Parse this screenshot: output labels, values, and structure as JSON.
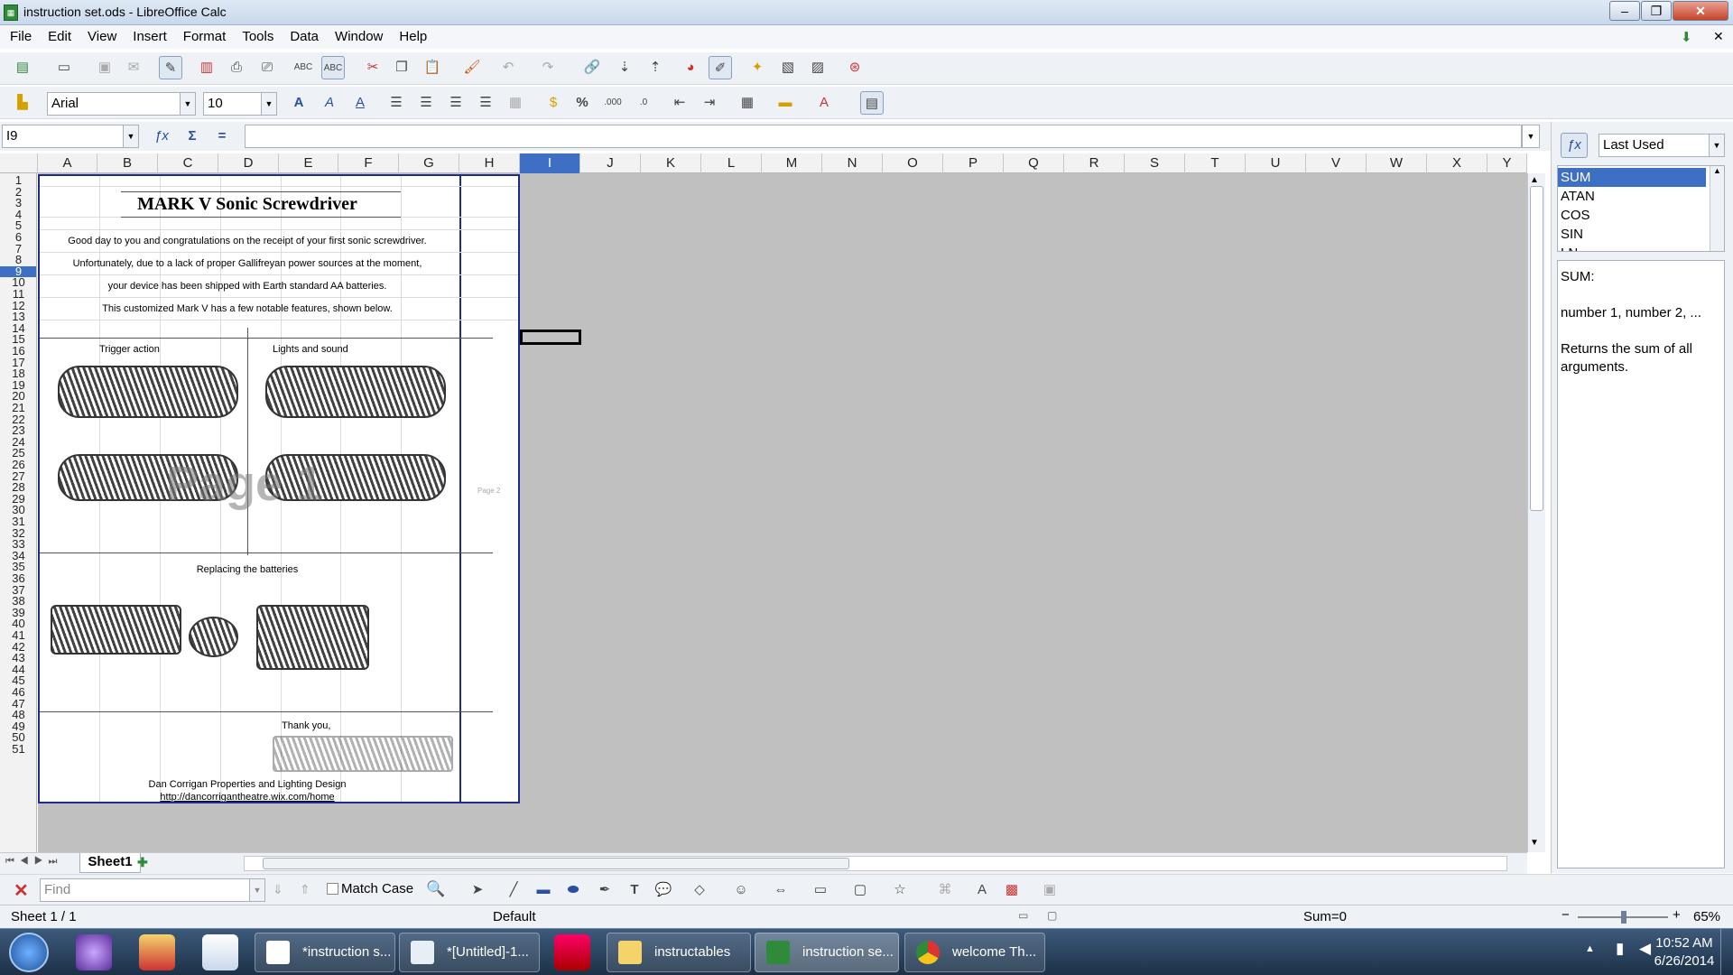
{
  "window": {
    "title": "instruction set.ods - LibreOffice Calc",
    "min": "–",
    "max": "❐",
    "close": "✕"
  },
  "menu": [
    "File",
    "Edit",
    "View",
    "Insert",
    "Format",
    "Tools",
    "Data",
    "Window",
    "Help"
  ],
  "format_toolbar": {
    "font_name": "Arial",
    "font_size": "10"
  },
  "formula_bar": {
    "name_box": "I9",
    "formula": ""
  },
  "columns": [
    "A",
    "B",
    "C",
    "D",
    "E",
    "F",
    "G",
    "H",
    "I",
    "J",
    "K",
    "L",
    "M",
    "N",
    "O",
    "P",
    "Q",
    "R",
    "S",
    "T",
    "U",
    "V",
    "W",
    "X",
    "Y"
  ],
  "selected_column": "I",
  "rows": [
    "1",
    "2",
    "3",
    "4",
    "5",
    "6",
    "7",
    "8",
    "9",
    "10",
    "11",
    "12",
    "13",
    "14",
    "15",
    "16",
    "17",
    "18",
    "19",
    "20",
    "21",
    "22",
    "23",
    "24",
    "25",
    "26",
    "27",
    "28",
    "29",
    "30",
    "31",
    "32",
    "33",
    "34",
    "35",
    "36",
    "37",
    "38",
    "39",
    "40",
    "41",
    "42",
    "43",
    "44",
    "45",
    "46",
    "47",
    "48",
    "49",
    "50",
    "51"
  ],
  "document": {
    "title": "MARK V Sonic Screwdriver",
    "line1": "Good day to you and congratulations on the receipt of your first sonic screwdriver.",
    "line2": "Unfortunately, due to a lack of proper Gallifreyan power sources at the moment,",
    "line3": "your device has been shipped with Earth standard AA batteries.",
    "line4": "This customized Mark V has a few notable features, shown below.",
    "trigger": "Trigger action",
    "lights": "Lights and sound",
    "batteries": "Replacing the batteries",
    "thanks": "Thank you,",
    "footer1": "Dan Corrigan Properties and Lighting Design",
    "footer2": "http://dancorrigantheatre.wix.com/home",
    "page_watermark": "Page 1",
    "page2_label": "Page 2"
  },
  "sidebar": {
    "category": "Last Used",
    "functions": [
      "SUM",
      "ATAN",
      "COS",
      "SIN",
      "LN"
    ],
    "selected": "SUM",
    "desc_name": "SUM:",
    "desc_args": "number 1, number 2, ...",
    "desc_text": "Returns the sum of all arguments."
  },
  "sheet_tab": "Sheet1",
  "findbar": {
    "placeholder": "Find",
    "match_case": "Match Case"
  },
  "status": {
    "sheet": "Sheet 1 / 1",
    "style": "Default",
    "sum": "Sum=0",
    "zoom": "65%"
  },
  "taskbar": {
    "items": [
      "*instruction s...",
      "*[Untitled]-1...",
      "instructables",
      "instruction se...",
      "welcome Th..."
    ],
    "time": "10:52 AM",
    "date": "6/26/2014"
  }
}
